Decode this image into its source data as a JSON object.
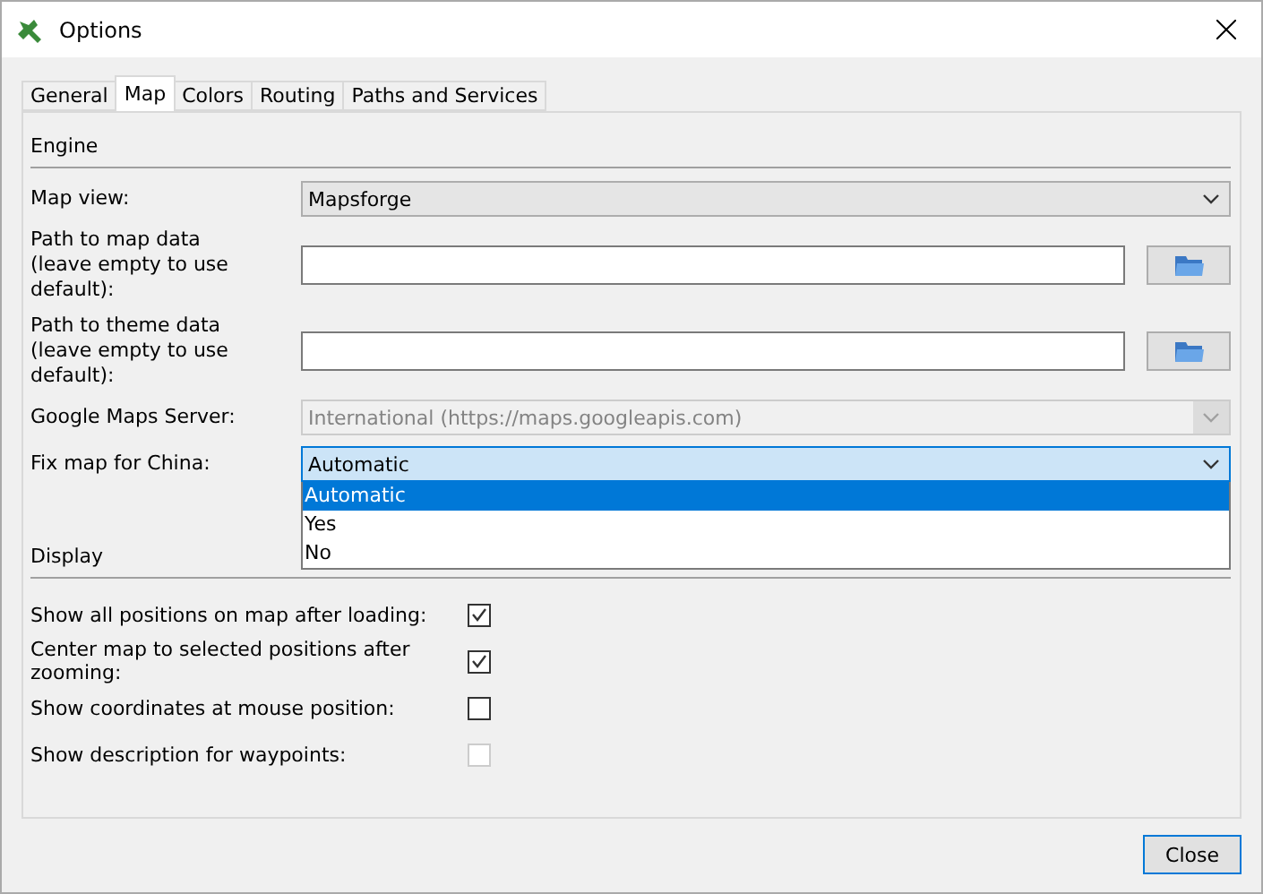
{
  "window": {
    "title": "Options"
  },
  "tabs": [
    {
      "label": "General",
      "selected": false
    },
    {
      "label": "Map",
      "selected": true
    },
    {
      "label": "Colors",
      "selected": false
    },
    {
      "label": "Routing",
      "selected": false
    },
    {
      "label": "Paths and Services",
      "selected": false
    }
  ],
  "engine": {
    "heading": "Engine",
    "fields": [
      {
        "kind": "combo",
        "label": "Map view:",
        "value": "Mapsforge",
        "disabled": false,
        "focused": false
      },
      {
        "kind": "path",
        "label": "Path to map data\n(leave empty to use default):"
      },
      {
        "kind": "path",
        "label": "Path to theme data\n(leave empty to use default):"
      },
      {
        "kind": "combo",
        "label": "Google Maps Server:",
        "value": "International (https://maps.googleapis.com)",
        "disabled": true,
        "focused": false
      },
      {
        "kind": "combo",
        "label": "Fix map for China:",
        "value": "Automatic",
        "disabled": false,
        "focused": true,
        "options": [
          {
            "label": "Automatic",
            "selected": true
          },
          {
            "label": "Yes",
            "selected": false
          },
          {
            "label": "No",
            "selected": false
          }
        ]
      }
    ]
  },
  "display": {
    "heading": "Display",
    "checkboxes": [
      {
        "label": "Show all positions on map after loading:",
        "checked": true,
        "disabled": false
      },
      {
        "label": "Center map to selected positions after zooming:",
        "checked": true,
        "disabled": false
      },
      {
        "label": "Show coordinates at mouse position:",
        "checked": false,
        "disabled": false
      },
      {
        "label": "Show description for waypoints:",
        "checked": false,
        "disabled": true
      }
    ]
  },
  "buttons": [
    {
      "label": "Close"
    }
  ]
}
